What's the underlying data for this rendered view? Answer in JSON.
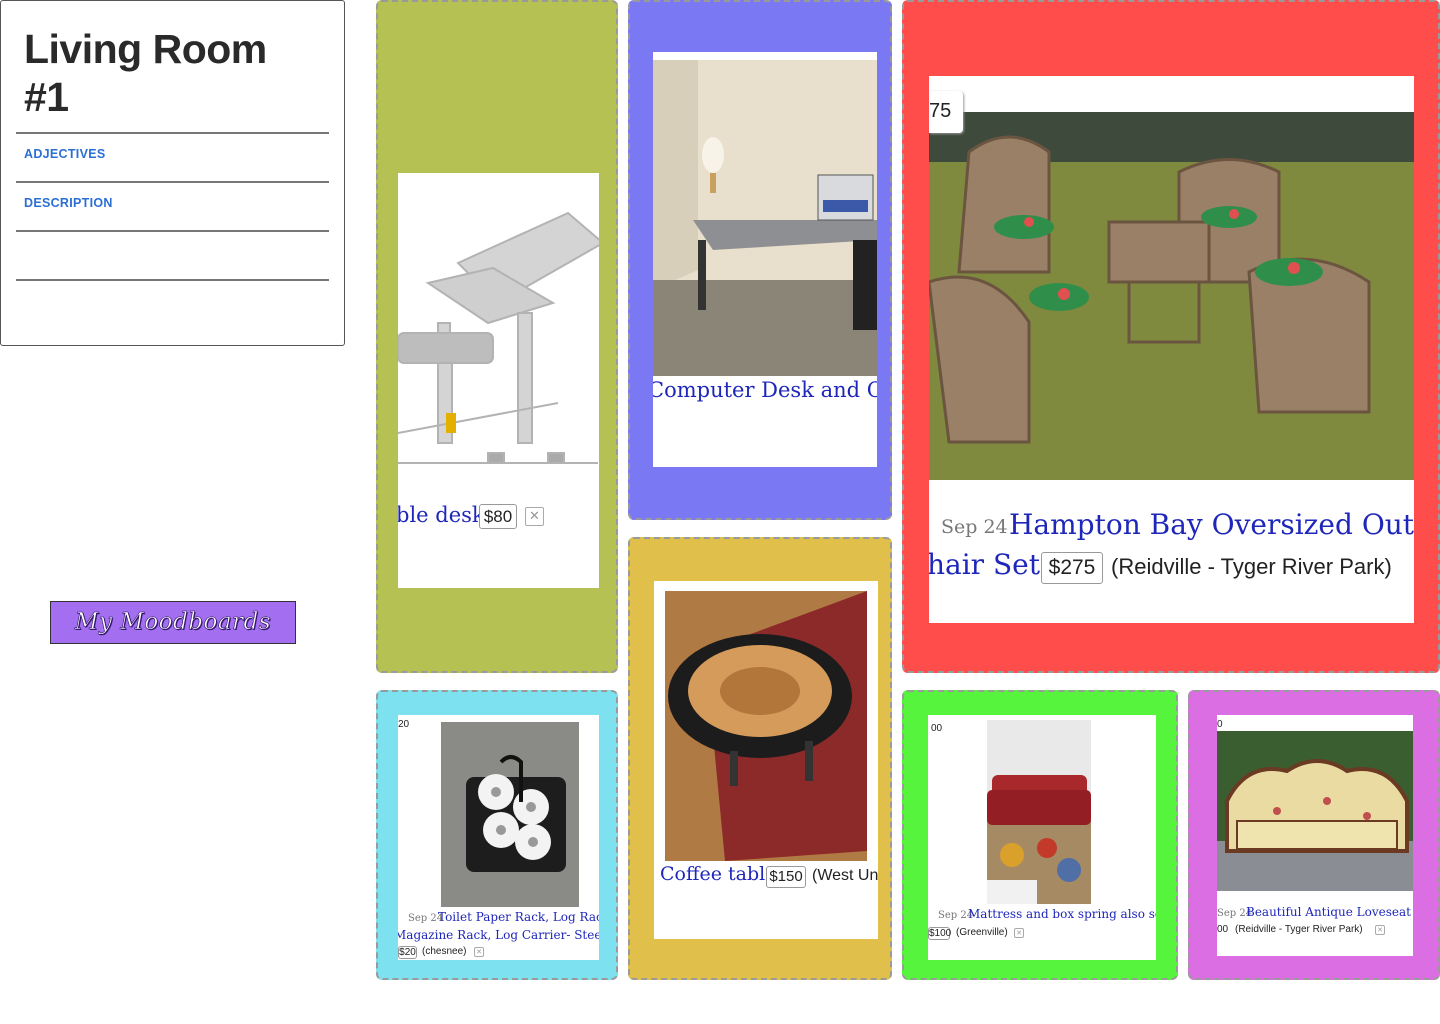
{
  "board": {
    "title": "Living Room #1",
    "sections": [
      "ADJECTIVES",
      "DESCRIPTION",
      ""
    ],
    "moodboards_button": "My Moodboards"
  },
  "colors": {
    "olive": "#b6c153",
    "indigo": "#7b78f4",
    "red": "#ff4d4b",
    "mustard": "#e0bf4b",
    "cyan": "#7de1ef",
    "green": "#57f43d",
    "violet": "#db6ee2",
    "link": "#1e27b9",
    "accent": "#2c6fd3"
  },
  "items": [
    {
      "id": "study-desk",
      "title": "ble desk",
      "price": "$80",
      "icons": [
        "study-desk-icon",
        "delete-icon"
      ]
    },
    {
      "id": "computer-desk",
      "title": "Computer Desk and Chair"
    },
    {
      "id": "hampton-bay",
      "date": "Sep 24",
      "title_line1": "Hampton Bay Oversized Outdoor",
      "title_line2": "hair Set!",
      "price": "$275",
      "location": "(Reidville - Tyger River Park)",
      "badge": "75"
    },
    {
      "id": "coffee-table",
      "title": "Coffee table",
      "price": "$150",
      "location": "(West Un"
    },
    {
      "id": "toilet-paper-rack",
      "date": "Sep 24",
      "title_line1": "Toilet Paper Rack, Log Rack,",
      "title_line2": "Magazine Rack, Log Carrier- Steel - Bl",
      "price": "$20",
      "location": "(chesnee)",
      "badge": "20"
    },
    {
      "id": "mattress-sofa",
      "date": "Sep 24",
      "title": "Mattress and box spring also sofa",
      "price": "$100",
      "location": "(Greenville)",
      "badge": "00"
    },
    {
      "id": "loveseat",
      "date": "Sep 24",
      "title": "Beautiful Antique Loveseat Set",
      "price": "00",
      "location": "(Reidville - Tyger River Park)",
      "badge": "0"
    }
  ]
}
